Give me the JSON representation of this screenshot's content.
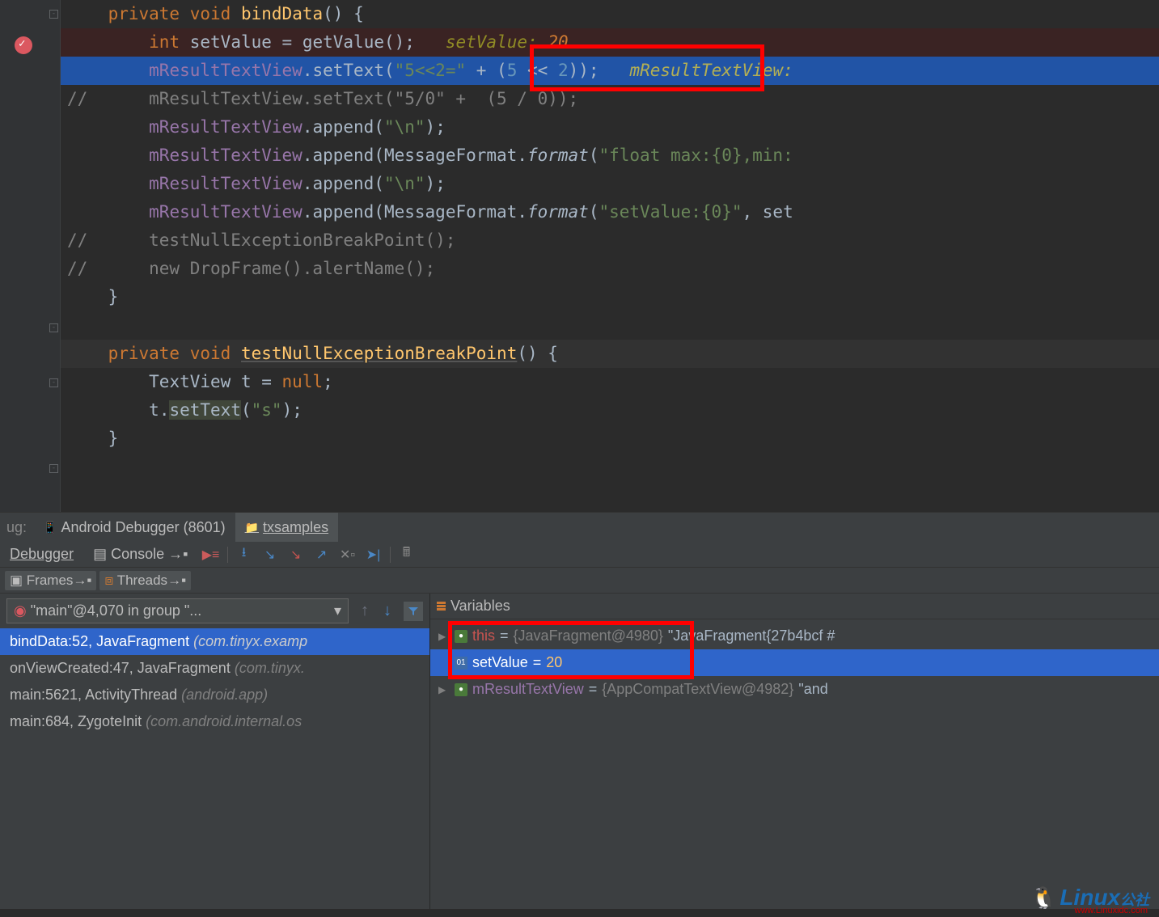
{
  "code": {
    "line1": {
      "kw1": "private",
      "kw2": "void",
      "fn": "bindData",
      "tail": "() {"
    },
    "line2": {
      "indent": "        ",
      "kw": "int",
      "var": "setValue",
      "eq": " = ",
      "call": "getValue();",
      "hint_label": "setValue:",
      "hint_val": "20"
    },
    "line3": {
      "indent": "        ",
      "field": "mResultTextView",
      "dot": ".setText(",
      "str": "\"5<<2=\"",
      "plus": " + (",
      "num1": "5",
      "op": " << ",
      "num2": "2",
      "close": "));",
      "hint": "mResultTextView:"
    },
    "line4": "//      mResultTextView.setText(\"5/0\" +  (5 / 0));",
    "line5": {
      "indent": "        ",
      "field": "mResultTextView",
      "dot": ".append(",
      "str": "\"\\n\"",
      "close": ");"
    },
    "line6": {
      "indent": "        ",
      "field": "mResultTextView",
      "dot": ".append(MessageFormat.",
      "fn": "format",
      "open": "(",
      "str": "\"float max:{0},min:",
      "tail": ""
    },
    "line7": {
      "indent": "        ",
      "field": "mResultTextView",
      "dot": ".append(",
      "str": "\"\\n\"",
      "close": ");"
    },
    "line8": {
      "indent": "        ",
      "field": "mResultTextView",
      "dot": ".append(MessageFormat.",
      "fn": "format",
      "open": "(",
      "str": "\"setValue:{0}\"",
      "tail": ", set"
    },
    "line9": "//      testNullExceptionBreakPoint();",
    "line10": "//      new DropFrame().alertName();",
    "line11": "    }",
    "blank": "",
    "line12": {
      "kw1": "private",
      "kw2": "void",
      "fn": "testNullExceptionBreakPoint",
      "tail": "() {"
    },
    "line13": {
      "indent": "        ",
      "type": "TextView t = ",
      "kw": "null",
      "tail": ";"
    },
    "line14": {
      "indent": "        ",
      "obj": "t",
      "dot": ".",
      "fn": "setText",
      "open": "(",
      "str": "\"s\"",
      "close": ");"
    },
    "line15": "    }"
  },
  "debugTabs": {
    "label1": "ug:",
    "tab1": "Android Debugger (8601)",
    "tab2": "txsamples"
  },
  "toolbar": {
    "debugger": "Debugger",
    "console": "Console"
  },
  "framesToolbar": {
    "frames": "Frames",
    "threads": "Threads"
  },
  "threadSelect": "\"main\"@4,070 in group \"...",
  "frames": [
    {
      "loc": "bindData:52, JavaFragment ",
      "pkg": "(com.tinyx.examp"
    },
    {
      "loc": "onViewCreated:47, JavaFragment ",
      "pkg": "(com.tinyx."
    },
    {
      "loc": "main:5621, ActivityThread ",
      "pkg": "(android.app)"
    },
    {
      "loc": "main:684, ZygoteInit ",
      "pkg": "(com.android.internal.os"
    }
  ],
  "variables": {
    "title": "Variables",
    "items": [
      {
        "name": "this",
        "eq": " = ",
        "type": "{JavaFragment@4980}",
        "val": " \"JavaFragment{27b4bcf #"
      },
      {
        "name": "setValue",
        "eq": " = ",
        "val": "20"
      },
      {
        "name": "mResultTextView",
        "eq": " = ",
        "type": "{AppCompatTextView@4982}",
        "val": " \"and"
      }
    ]
  },
  "watermark": {
    "text": "Linux",
    "sub": "公社",
    "url": "www.Linuxidc.com"
  }
}
